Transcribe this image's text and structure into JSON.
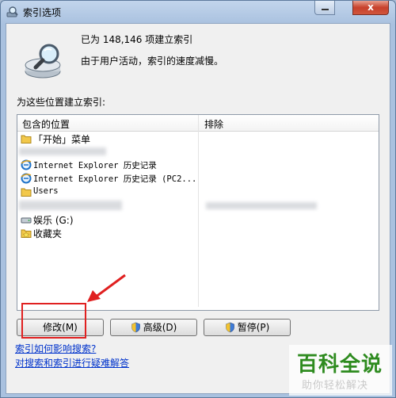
{
  "window": {
    "title": "索引选项",
    "close_glyph": "x"
  },
  "status": {
    "indexed_line": "已为 148,146 项建立索引",
    "speed_line": "由于用户活动，索引的速度减慢。"
  },
  "locations_label": "为这些位置建立索引:",
  "list": {
    "header_included": "包含的位置",
    "header_excluded": "排除",
    "items": [
      {
        "label": "「开始」菜单",
        "icon": "folder-icon"
      },
      {
        "label": "Internet Explorer 历史记录",
        "icon": "ie-icon"
      },
      {
        "label": "Internet Explorer 历史记录 (PC2...",
        "icon": "ie-icon"
      },
      {
        "label": "Users",
        "icon": "folder-icon"
      },
      {
        "label": "娱乐 (G:)",
        "icon": "drive-icon"
      },
      {
        "label": "收藏夹",
        "icon": "favorites-folder-icon"
      }
    ]
  },
  "buttons": {
    "modify": "修改(M)",
    "advanced": "高级(D)",
    "pause": "暂停(P)"
  },
  "links": {
    "how_index_affects": "索引如何影响搜索?",
    "troubleshoot": "对搜索和索引进行疑难解答"
  },
  "watermark": {
    "title": "百科全说",
    "subtitle": "助你轻松解决"
  },
  "colors": {
    "annotation": "#e02020",
    "link": "#0033cc",
    "watermark_green": "#2e8b1f"
  }
}
